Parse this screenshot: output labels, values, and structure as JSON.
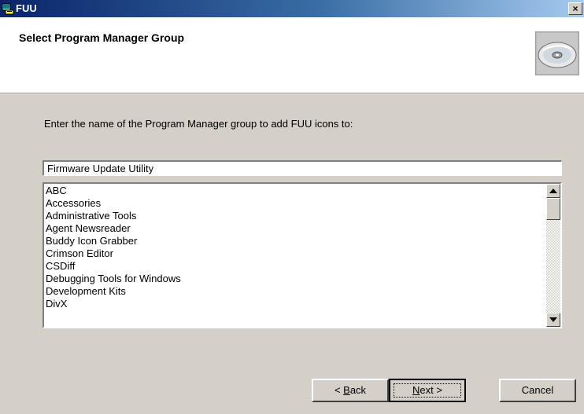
{
  "window": {
    "title": "FUU",
    "close_label": "×",
    "icon": "setup-app-icon"
  },
  "header": {
    "heading": "Select Program Manager Group",
    "icon": "cd-disc-icon"
  },
  "body": {
    "instruction": "Enter the name of the Program Manager group to add FUU icons to:",
    "group_name_value": "Firmware Update Utility",
    "groups": [
      "ABC",
      "Accessories",
      "Administrative Tools",
      "Agent Newsreader",
      "Buddy Icon Grabber",
      "Crimson Editor",
      "CSDiff",
      "Debugging Tools for Windows",
      "Development Kits",
      "DivX"
    ]
  },
  "buttons": {
    "back_prefix": "< ",
    "back_accel": "B",
    "back_rest": "ack",
    "next_accel": "N",
    "next_rest": "ext >",
    "cancel": "Cancel"
  }
}
